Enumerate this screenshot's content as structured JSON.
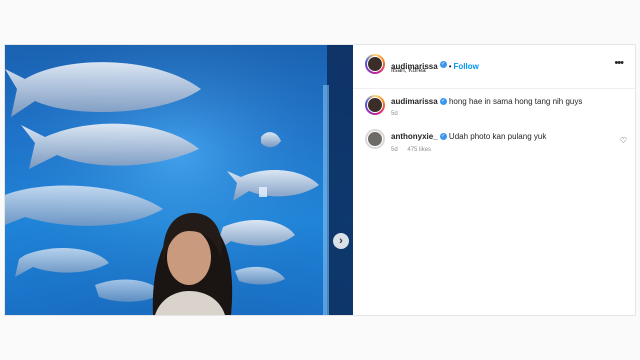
{
  "post": {
    "author": "audimarissa",
    "follow_label": "Follow",
    "location": "Ilsan, Korea",
    "dot": "•",
    "more_icon": "more-horizontal-icon"
  },
  "comments": [
    {
      "username": "audimarissa",
      "text": "hong hae in sama hong tang nih guys",
      "age": "5d",
      "likes": ""
    },
    {
      "username": "anthonyxie_",
      "text": "Udah photo kan pulang yuk",
      "age": "5d",
      "likes": "475 likes"
    }
  ],
  "colors": {
    "accent": "#0095f6",
    "verified": "#3897f0",
    "aquarium": "#1d76cf"
  }
}
